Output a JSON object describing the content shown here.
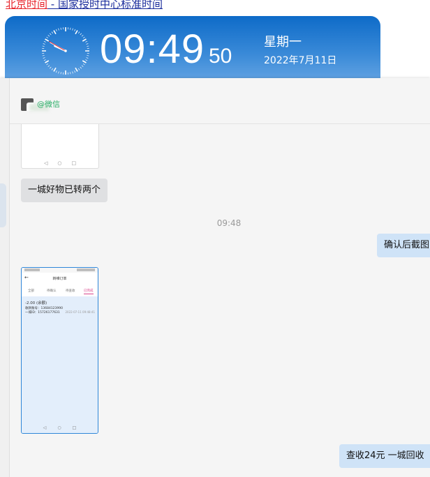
{
  "top_link": {
    "part1": "北京时间",
    "part2": " - 国家授时中心标准时间",
    "color_red": "#e8242b",
    "color_blue": "#1a2c9c"
  },
  "clock": {
    "hh_mm": "09:49",
    "seconds": "50",
    "weekday": "星期一",
    "date": "2022年7月11日",
    "analog": {
      "hour": 9,
      "minute": 49,
      "second": 50
    },
    "banner_color": "#1f78d1"
  },
  "chat": {
    "header": {
      "tag": "@微信",
      "tag_color": "#2aae67"
    },
    "messages": [
      {
        "side": "left",
        "type": "image",
        "nav": [
          "◁",
          "○",
          "□"
        ]
      },
      {
        "side": "left",
        "type": "text",
        "text": "一城好物已转两个"
      },
      {
        "type": "timestamp",
        "text": "09:48"
      },
      {
        "side": "right",
        "type": "text",
        "text": "确认后截图"
      },
      {
        "side": "left",
        "type": "image",
        "screenshot": {
          "title": "转维订单",
          "tabs": [
            "全部",
            "待确认",
            "待查收",
            "已完成"
          ],
          "amount": "-2.00 (余额)",
          "line1": "收款账号：13684123990",
          "line2": "一城ID：15726177631",
          "date": "2022-07-11 09:48:41",
          "nav": [
            "◁",
            "○",
            "□"
          ]
        }
      },
      {
        "side": "right",
        "type": "text",
        "text": "查收24元   一城回收"
      }
    ],
    "bubble_right_color": "#cfe3f7",
    "bubble_left_color": "#dfe0e2"
  }
}
